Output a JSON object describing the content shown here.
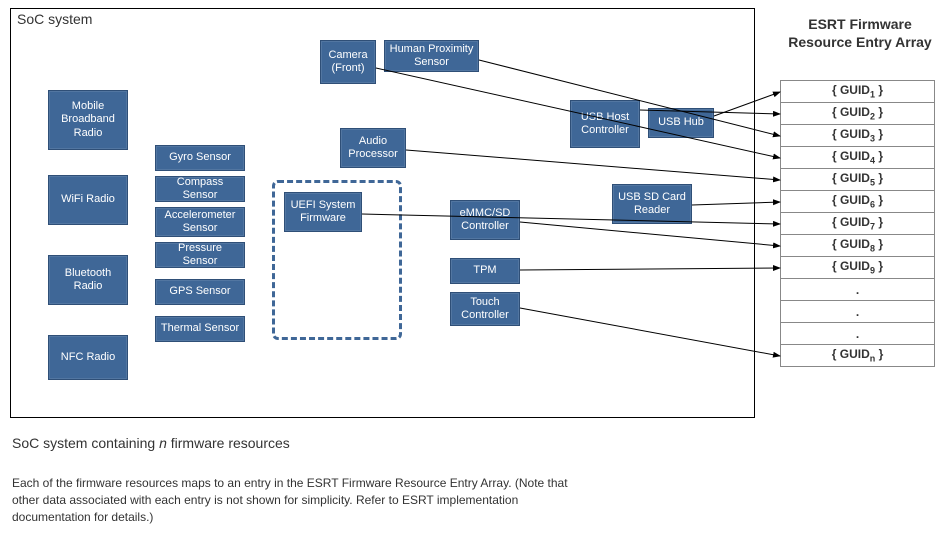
{
  "soc": {
    "title": "SoC system",
    "radios": [
      "Mobile Broadband Radio",
      "WiFi Radio",
      "Bluetooth Radio",
      "NFC Radio"
    ],
    "sensors": [
      "Gyro Sensor",
      "Compass Sensor",
      "Accelerometer Sensor",
      "Pressure Sensor",
      "GPS Sensor",
      "Thermal Sensor"
    ],
    "firmware_block": "UEFI System Firmware",
    "camera": "Camera (Front)",
    "proximity": "Human Proximity Sensor",
    "audio": "Audio Processor",
    "emmc": "eMMC/SD Controller",
    "tpm": "TPM",
    "touch": "Touch Controller",
    "usb_host": "USB Host Controller",
    "usb_hub": "USB Hub",
    "usb_sd": "USB SD Card Reader"
  },
  "esrt": {
    "title": "ESRT Firmware Resource Entry Array",
    "rows": [
      "{ GUID1 }",
      "{ GUID2 }",
      "{ GUID3 }",
      "{ GUID4 }",
      "{ GUID5 }",
      "{ GUID6 }",
      "{ GUID7 }",
      "{ GUID8 }",
      "{ GUID9 }",
      ".",
      ".",
      ".",
      "{ GUIDn }"
    ],
    "row_subs": [
      "1",
      "2",
      "3",
      "4",
      "5",
      "6",
      "7",
      "8",
      "9",
      "",
      "",
      "",
      "n"
    ]
  },
  "caption": "SoC system containing n firmware resources",
  "description": "Each of the firmware resources maps to an entry in the ESRT Firmware Resource Entry Array. (Note that other data associated with each entry is not shown for simplicity. Refer to ESRT implementation documentation for details.)"
}
